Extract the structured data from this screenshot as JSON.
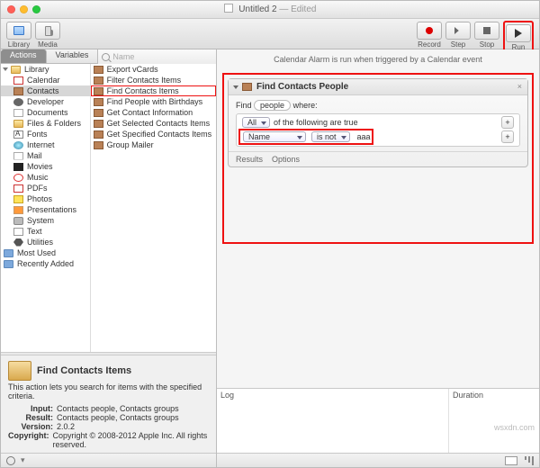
{
  "title": {
    "name": "Untitled 2",
    "edited": "— Edited"
  },
  "toolbar": {
    "library": "Library",
    "media": "Media",
    "record": "Record",
    "step": "Step",
    "stop": "Stop",
    "run": "Run"
  },
  "tabs": {
    "actions": "Actions",
    "variables": "Variables"
  },
  "search": {
    "placeholder": "Name"
  },
  "library_header": "Library",
  "library": [
    {
      "label": "Calendar",
      "cls": "cal"
    },
    {
      "label": "Contacts",
      "cls": "book",
      "sel": true
    },
    {
      "label": "Developer",
      "cls": "dev"
    },
    {
      "label": "Documents",
      "cls": "doc"
    },
    {
      "label": "Files & Folders",
      "cls": "fold"
    },
    {
      "label": "Fonts",
      "cls": "font"
    },
    {
      "label": "Internet",
      "cls": "net"
    },
    {
      "label": "Mail",
      "cls": "mail"
    },
    {
      "label": "Movies",
      "cls": "mov"
    },
    {
      "label": "Music",
      "cls": "mus"
    },
    {
      "label": "PDFs",
      "cls": "pdf"
    },
    {
      "label": "Photos",
      "cls": "pho"
    },
    {
      "label": "Presentations",
      "cls": "pre"
    },
    {
      "label": "System",
      "cls": "sys"
    },
    {
      "label": "Text",
      "cls": "txt"
    },
    {
      "label": "Utilities",
      "cls": "util"
    }
  ],
  "library_tags": [
    {
      "label": "Most Used"
    },
    {
      "label": "Recently Added"
    }
  ],
  "actions": [
    {
      "label": "Export vCards"
    },
    {
      "label": "Filter Contacts Items"
    },
    {
      "label": "Find Contacts Items",
      "hl": true
    },
    {
      "label": "Find People with Birthdays"
    },
    {
      "label": "Get Contact Information"
    },
    {
      "label": "Get Selected Contacts Items"
    },
    {
      "label": "Get Specified Contacts Items"
    },
    {
      "label": "Group Mailer"
    }
  ],
  "detail": {
    "title": "Find Contacts Items",
    "desc": "This action lets you search for items with the specified criteria.",
    "input_k": "Input:",
    "input_v": "Contacts people, Contacts groups",
    "result_k": "Result:",
    "result_v": "Contacts people, Contacts groups",
    "version_k": "Version:",
    "version_v": "2.0.2",
    "copyright_k": "Copyright:",
    "copyright_v": "Copyright © 2008-2012 Apple Inc.  All rights reserved."
  },
  "workflow": {
    "hint": "Calendar Alarm is run when triggered by a Calendar event",
    "action_title": "Find Contacts People",
    "find_label": "Find",
    "find_target": "people",
    "where": "where:",
    "scope": "All",
    "scope_text": "of the following are true",
    "field": "Name",
    "op": "is not",
    "value": "aaa",
    "results": "Results",
    "options": "Options"
  },
  "log": {
    "log": "Log",
    "duration": "Duration"
  },
  "watermark": "wsxdn.com"
}
